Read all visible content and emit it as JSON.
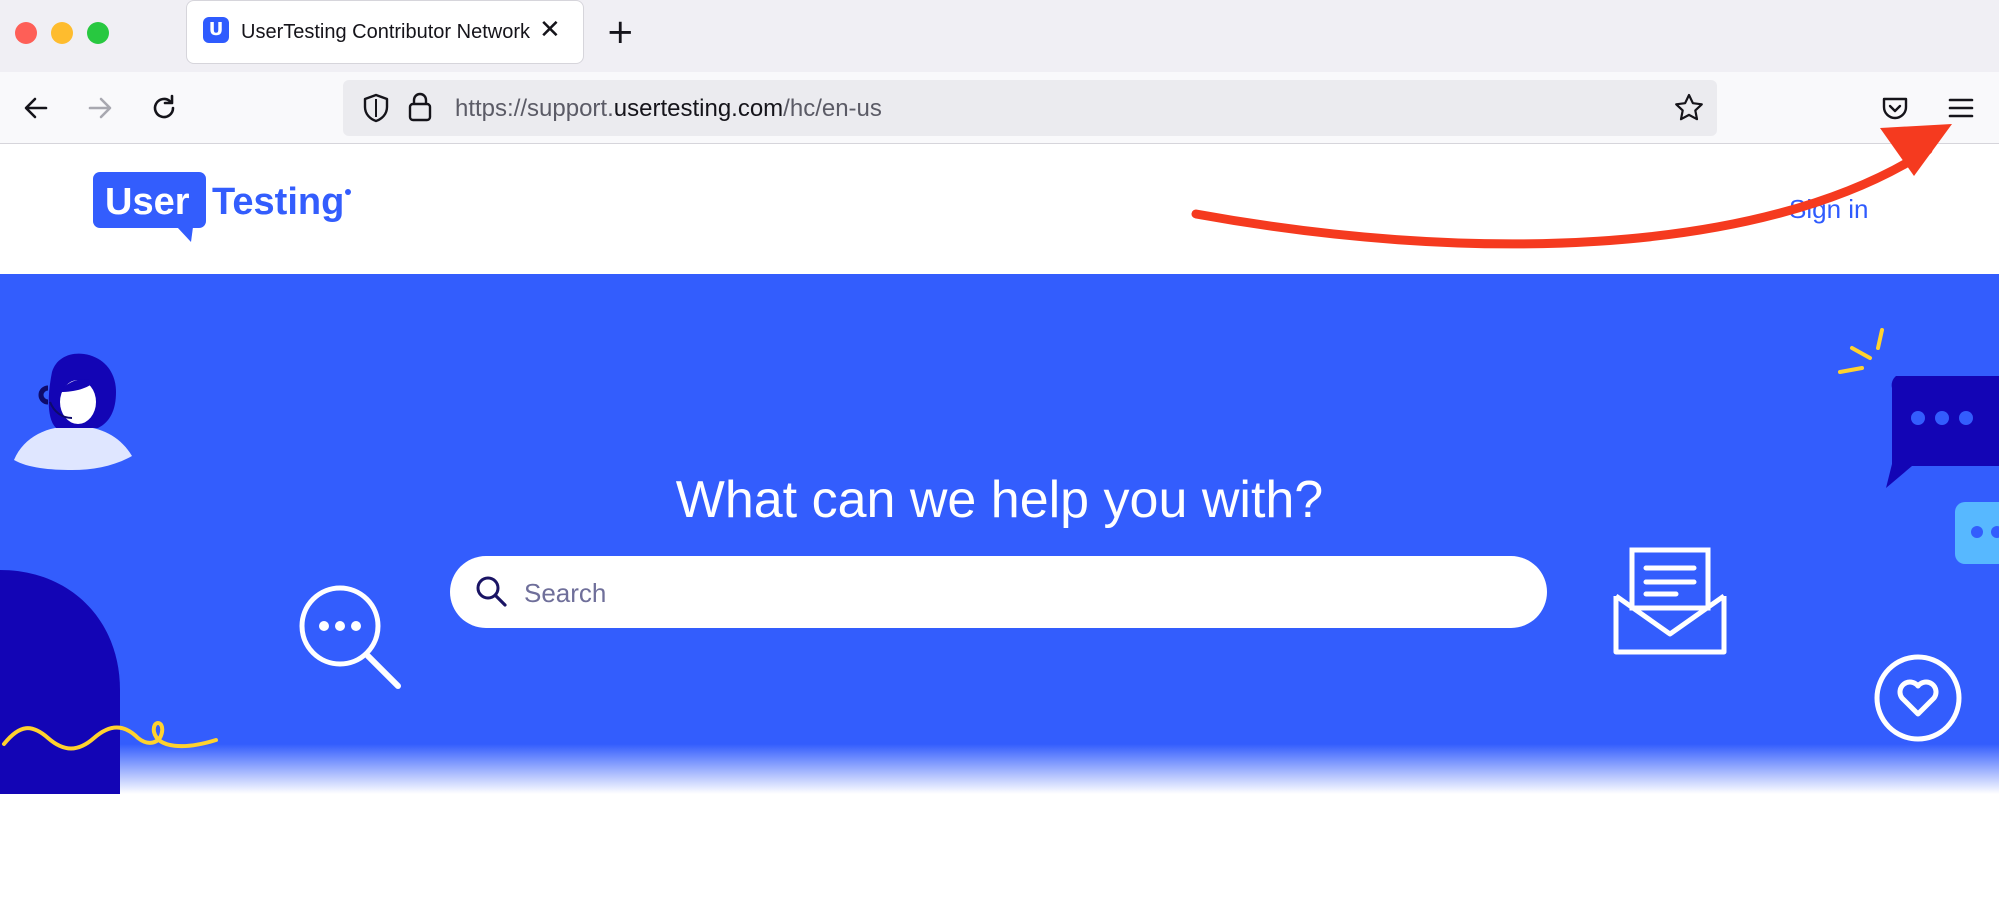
{
  "browser": {
    "tab_title": "UserTesting Contributor Network",
    "tab_favicon_letter": "U",
    "url_prefix": "https://support.",
    "url_domain": "usertesting.com",
    "url_path": "/hc/en-us"
  },
  "header": {
    "logo_word1": "User",
    "logo_word2": "Testing",
    "sign_in": "Sign in"
  },
  "hero": {
    "title": "What can we help you with?",
    "search_placeholder": "Search"
  },
  "colors": {
    "brand_blue": "#335dfd",
    "annotation_arrow": "#f53a1f",
    "accent_yellow": "#ffd22e",
    "navy": "#1305b5"
  },
  "icons": [
    "back-arrow-icon",
    "forward-arrow-icon",
    "reload-icon",
    "shield-icon",
    "lock-icon",
    "star-icon",
    "pocket-icon",
    "menu-icon",
    "search-icon",
    "magnifier-chat-icon",
    "envelope-icon",
    "heart-icon",
    "chat-bubble-icon",
    "support-agent-illustration"
  ]
}
